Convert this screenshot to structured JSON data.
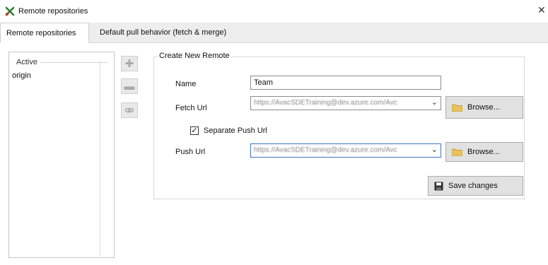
{
  "window": {
    "title": "Remote repositories",
    "close_glyph": "✕"
  },
  "tabs": [
    {
      "label": "Remote repositories",
      "active": true
    },
    {
      "label": "Default pull behavior (fetch & merge)",
      "active": false
    }
  ],
  "remotes_list": {
    "header": "Active",
    "items": [
      "origin"
    ]
  },
  "side_buttons": {
    "add_icon": "plus-icon",
    "remove_icon": "minus-icon",
    "link_icon": "link-icon"
  },
  "form": {
    "legend": "Create New Remote",
    "name_label": "Name",
    "name_value": "Team",
    "fetch_label": "Fetch Url",
    "fetch_value": "https://AvacSDETraining@dev.azure.com/Avc",
    "separate_push_label": "Separate Push Url",
    "separate_push_checked": true,
    "push_label": "Push Url",
    "push_value": "https://AvacSDETraining@dev.azure.com/Avc",
    "browse_label": "Browse...",
    "save_label": "Save changes"
  },
  "colors": {
    "app_icon": "#2f7d32",
    "folder": "#e8c25c",
    "focus": "#3c74c4"
  }
}
